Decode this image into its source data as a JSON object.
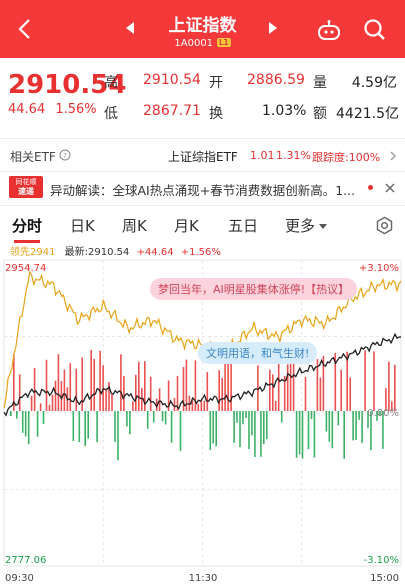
{
  "header": {
    "title": "上证指数",
    "code": "1A0001",
    "level_tag": "L1",
    "bg_color": "#f5393a"
  },
  "quote": {
    "price": "2910.54",
    "change": "44.64",
    "change_pct": "1.56%",
    "high_label": "高",
    "high": "2910.54",
    "open_label": "开",
    "open": "2886.59",
    "volume_label": "量",
    "volume": "4.59亿",
    "low_label": "低",
    "low": "2867.71",
    "turnover_label": "换",
    "turnover": "1.03%",
    "amount_label": "额",
    "amount": "4421.5亿"
  },
  "etf": {
    "label": "相关ETF",
    "name": "上证综指ETF",
    "price": "1.01",
    "pct": "1.31%",
    "tracking": "跟踪度:100%"
  },
  "news": {
    "badge_top": "同花顺",
    "badge_bottom": "速递",
    "text": "异动解读：全球AI热点涌现+春节消费数据创新高。1..."
  },
  "tabs": [
    "分时",
    "日K",
    "周K",
    "月K",
    "五日",
    "更多"
  ],
  "legend": {
    "leading": "领先2941",
    "latest": "最新:2910.54",
    "change": "+44.64",
    "pct": "+1.56%"
  },
  "axis": {
    "top_left": "2954.74",
    "bottom_left": "2777.06",
    "top_right": "+3.10%",
    "mid_right": "0.00%",
    "bottom_right": "-3.10%",
    "times": [
      "09:30",
      "11:30",
      "15:00"
    ]
  },
  "bubbles": {
    "pink": "梦回当年，AI明星股集体涨停!【热议】",
    "blue": "文明用语，和气生财!"
  },
  "colors": {
    "up": "#e93030",
    "down": "#1aa34a",
    "leading_line": "#e8a317",
    "price_line": "#222222"
  },
  "chart_data": {
    "type": "line",
    "ylim": [
      2777.06,
      2954.74
    ],
    "pct_range": [
      -3.1,
      3.1
    ],
    "prev_close": 2865.9,
    "x": [
      "09:30",
      "09:45",
      "10:00",
      "10:15",
      "10:30",
      "10:45",
      "11:00",
      "11:15",
      "11:30",
      "13:15",
      "13:30",
      "13:45",
      "14:00",
      "14:15",
      "14:30",
      "14:45",
      "15:00"
    ],
    "series": [
      {
        "name": "领先2941",
        "values": [
          2870,
          2945,
          2940,
          2920,
          2928,
          2915,
          2920,
          2908,
          2905,
          2902,
          2915,
          2910,
          2920,
          2918,
          2932,
          2940,
          2941
        ]
      },
      {
        "name": "最新:2910.54",
        "values": [
          2866,
          2878,
          2878,
          2872,
          2880,
          2876,
          2872,
          2870,
          2874,
          2874,
          2878,
          2884,
          2890,
          2895,
          2900,
          2906,
          2910.54
        ]
      }
    ]
  }
}
